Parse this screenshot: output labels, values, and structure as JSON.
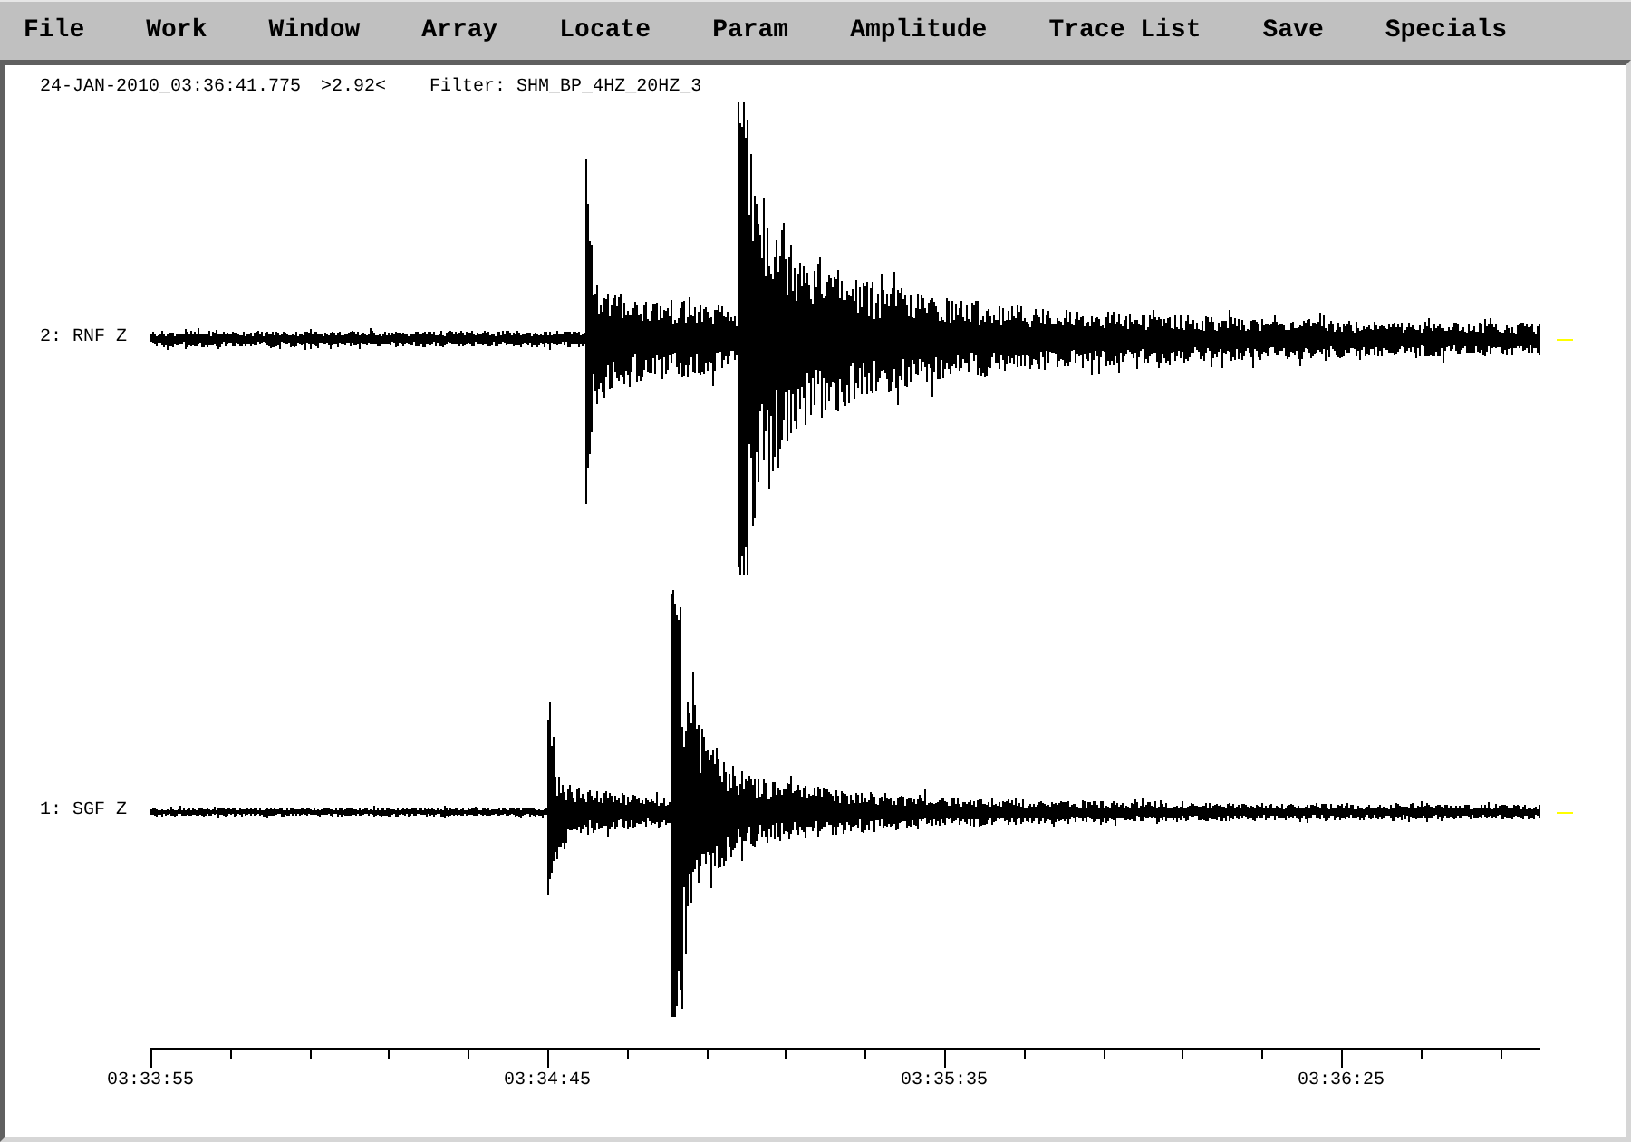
{
  "menu": [
    "File",
    "Work",
    "Window",
    "Array",
    "Locate",
    "Param",
    "Amplitude",
    "Trace List",
    "Save",
    "Specials"
  ],
  "header": {
    "timestamp": "24-JAN-2010_03:36:41.775",
    "scale": ">2.92<",
    "filter": "Filter: SHM_BP_4HZ_20HZ_3"
  },
  "traces": [
    {
      "label": "2: RNF Z"
    },
    {
      "label": "1: SGF Z"
    }
  ],
  "time_axis": {
    "ticks": [
      "03:33:55",
      "03:34:45",
      "03:35:35",
      "03:36:25"
    ]
  }
}
